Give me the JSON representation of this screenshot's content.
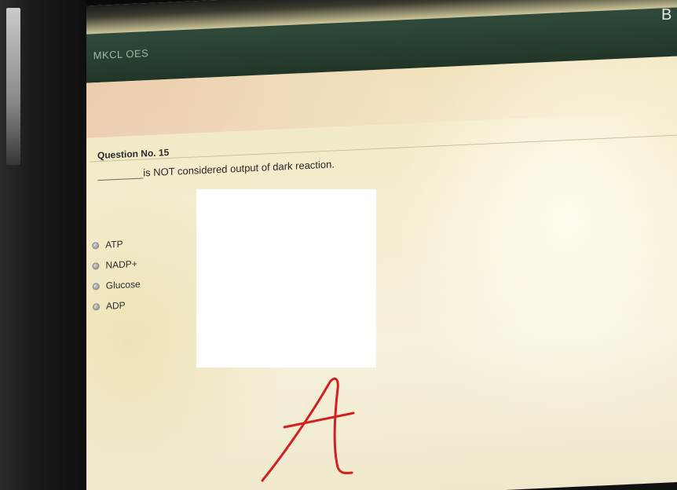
{
  "corner_text": "B",
  "app": {
    "title": "MKCL OES",
    "subtitle": ""
  },
  "question": {
    "number_label": "Question No. 15",
    "text": "is NOT considered output of dark reaction.",
    "options": [
      {
        "label": "ATP"
      },
      {
        "label": "NADP+"
      },
      {
        "label": "Glucose"
      },
      {
        "label": "ADP"
      }
    ]
  },
  "annotation": {
    "handwritten_answer": "A",
    "ink_color": "#d21f1f"
  },
  "colors": {
    "header_bar": "#2f4a3b",
    "screen_background": "#f3eccb",
    "redaction_box": "#ffffff"
  }
}
